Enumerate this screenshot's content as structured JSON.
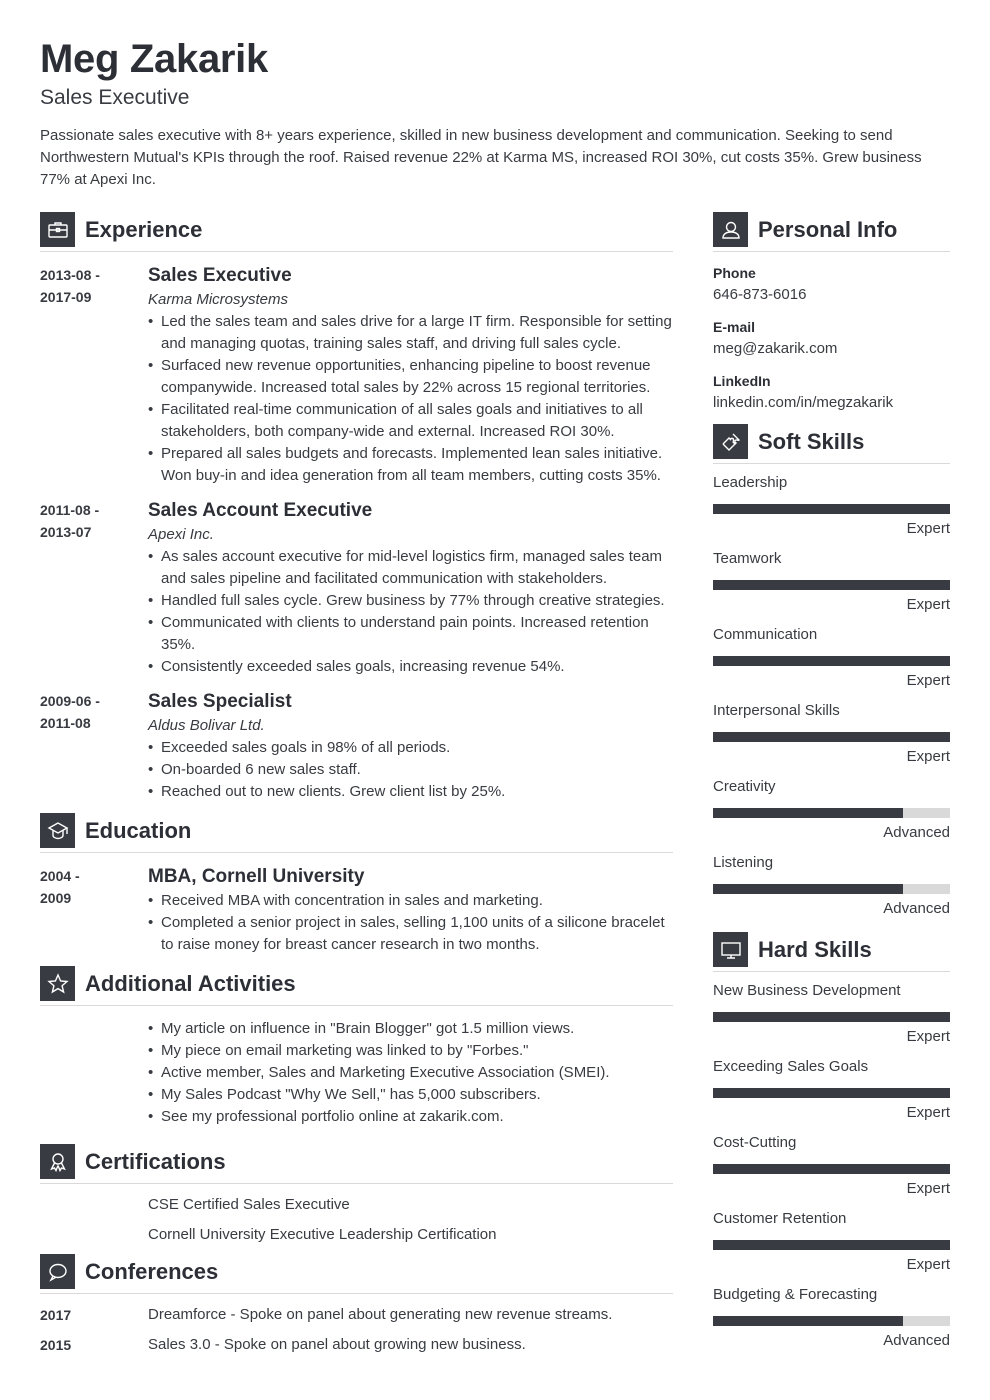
{
  "header": {
    "name": "Meg Zakarik",
    "title": "Sales Executive",
    "summary": "Passionate sales executive with 8+ years experience, skilled in new business development and communication. Seeking to send Northwestern Mutual's KPIs through the roof. Raised revenue 22% at Karma MS, increased ROI 30%, cut costs 35%. Grew business 77% at Apexi Inc."
  },
  "experience": {
    "title": "Experience",
    "icon": "briefcase-icon",
    "entries": [
      {
        "date_start": "2013-08 -",
        "date_end": "2017-09",
        "role": "Sales Executive",
        "company": "Karma Microsystems",
        "bullets": [
          "Led the sales team and sales drive for a large IT firm. Responsible for setting and managing quotas, training sales staff, and driving full sales cycle.",
          "Surfaced new revenue opportunities, enhancing pipeline to boost revenue companywide. Increased total sales by 22% across 15 regional territories.",
          "Facilitated real-time communication of all sales goals and initiatives to all stakeholders, both company-wide and external. Increased ROI 30%.",
          "Prepared all sales budgets and forecasts. Implemented lean sales initiative. Won buy-in and idea generation from all team members, cutting costs 35%."
        ]
      },
      {
        "date_start": "2011-08 -",
        "date_end": "2013-07",
        "role": "Sales Account Executive",
        "company": "Apexi Inc.",
        "bullets": [
          "As sales account executive for mid-level logistics firm, managed sales team and sales pipeline and facilitated communication with stakeholders.",
          "Handled full sales cycle. Grew business by 77% through creative strategies.",
          "Communicated with clients to understand pain points. Increased retention 35%.",
          "Consistently exceeded sales goals, increasing revenue 54%."
        ]
      },
      {
        "date_start": "2009-06 -",
        "date_end": "2011-08",
        "role": "Sales Specialist",
        "company": "Aldus Bolivar Ltd.",
        "bullets": [
          "Exceeded sales goals in 98% of all periods.",
          "On-boarded 6 new sales staff.",
          "Reached out to new clients. Grew client list by 25%."
        ]
      }
    ]
  },
  "education": {
    "title": "Education",
    "icon": "graduation-cap-icon",
    "entries": [
      {
        "date_start": "2004 -",
        "date_end": "2009",
        "degree": "MBA, Cornell University",
        "bullets": [
          "Received MBA with concentration in sales and marketing.",
          "Completed a senior project in sales, selling 1,100 units of a silicone bracelet to raise money for breast cancer research in two months."
        ]
      }
    ]
  },
  "activities": {
    "title": "Additional Activities",
    "icon": "star-icon",
    "bullets": [
      "My article on influence in \"Brain Blogger\" got 1.5 million views.",
      "My piece on email marketing was linked to by \"Forbes.\"",
      "Active member, Sales and Marketing Executive Association (SMEI).",
      "My Sales Podcast \"Why We Sell,\" has 5,000 subscribers.",
      "See my professional portfolio online at zakarik.com."
    ]
  },
  "certifications": {
    "title": "Certifications",
    "icon": "award-ribbon-icon",
    "items": [
      "CSE Certified Sales Executive",
      "Cornell University Executive Leadership Certification"
    ]
  },
  "conferences": {
    "title": "Conferences",
    "icon": "speech-bubble-icon",
    "items": [
      {
        "year": "2017",
        "text": "Dreamforce - Spoke on panel about generating new revenue streams."
      },
      {
        "year": "2015",
        "text": "Sales 3.0 - Spoke on panel about growing new business."
      }
    ]
  },
  "personal_info": {
    "title": "Personal Info",
    "icon": "user-icon",
    "fields": [
      {
        "label": "Phone",
        "value": "646-873-6016"
      },
      {
        "label": "E-mail",
        "value": "meg@zakarik.com"
      },
      {
        "label": "LinkedIn",
        "value": "linkedin.com/in/megzakarik"
      }
    ]
  },
  "soft_skills": {
    "title": "Soft Skills",
    "icon": "puzzle-piece-icon",
    "items": [
      {
        "name": "Leadership",
        "level": "Expert",
        "fill_percent": 100
      },
      {
        "name": "Teamwork",
        "level": "Expert",
        "fill_percent": 100
      },
      {
        "name": "Communication",
        "level": "Expert",
        "fill_percent": 100
      },
      {
        "name": "Interpersonal Skills",
        "level": "Expert",
        "fill_percent": 100
      },
      {
        "name": "Creativity",
        "level": "Advanced",
        "fill_percent": 80
      },
      {
        "name": "Listening",
        "level": "Advanced",
        "fill_percent": 80
      }
    ]
  },
  "hard_skills": {
    "title": "Hard Skills",
    "icon": "monitor-icon",
    "items": [
      {
        "name": "New Business Development",
        "level": "Expert",
        "fill_percent": 100
      },
      {
        "name": "Exceeding Sales Goals",
        "level": "Expert",
        "fill_percent": 100
      },
      {
        "name": "Cost-Cutting",
        "level": "Expert",
        "fill_percent": 100
      },
      {
        "name": "Customer Retention",
        "level": "Expert",
        "fill_percent": 100
      },
      {
        "name": "Budgeting & Forecasting",
        "level": "Advanced",
        "fill_percent": 80
      }
    ]
  },
  "colors": {
    "text": "#383b41",
    "heading": "#2c2f36",
    "icon_bg": "#383b41",
    "bar_fill": "#383b41",
    "bar_track": "#d9d9d9",
    "rule": "#d9d9d9"
  }
}
